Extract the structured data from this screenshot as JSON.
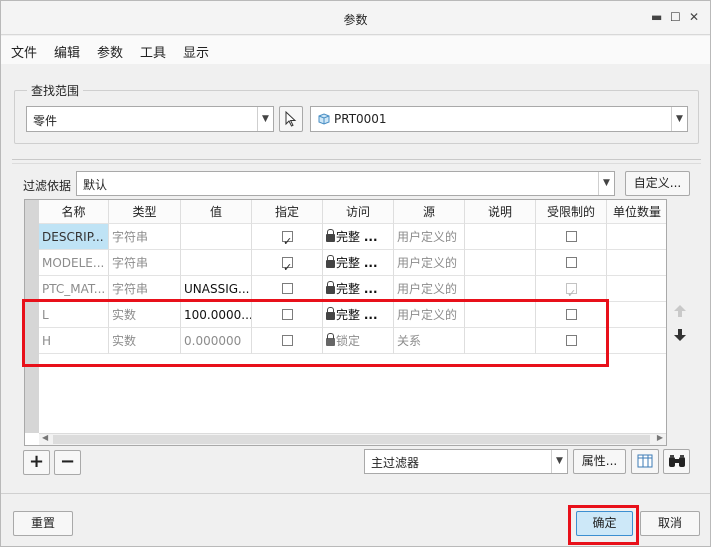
{
  "window": {
    "title": "参数",
    "minimize": "▬",
    "maximize": "☐",
    "close": "✕"
  },
  "menu": [
    "文件",
    "编辑",
    "参数",
    "工具",
    "显示"
  ],
  "search_scope": {
    "label": "查找范围",
    "type_value": "零件",
    "part_value": "PRT0001"
  },
  "filter": {
    "label": "过滤依据",
    "value": "默认",
    "customize_label": "自定义..."
  },
  "table": {
    "columns": [
      "名称",
      "类型",
      "值",
      "指定",
      "访问",
      "源",
      "说明",
      "受限制的",
      "单位数量"
    ],
    "rows": [
      {
        "name": "DESCRIP...",
        "type": "字符串",
        "value": "",
        "designated": true,
        "access": "完整",
        "source": "用户定义的",
        "restricted": false,
        "restricted_disabled": false
      },
      {
        "name": "MODELE...",
        "type": "字符串",
        "value": "",
        "designated": true,
        "access": "完整",
        "source": "用户定义的",
        "restricted": false,
        "restricted_disabled": false
      },
      {
        "name": "PTC_MAT...",
        "type": "字符串",
        "value": "UNASSIG...",
        "designated": false,
        "access": "完整",
        "source": "用户定义的",
        "restricted": true,
        "restricted_disabled": true
      },
      {
        "name": "L",
        "type": "实数",
        "value": "100.0000...",
        "designated": false,
        "access": "完整",
        "source": "用户定义的",
        "restricted": false,
        "restricted_disabled": false
      },
      {
        "name": "H",
        "type": "实数",
        "value": "0.000000",
        "designated": false,
        "access": "锁定",
        "source": "关系",
        "restricted": false,
        "restricted_disabled": false
      }
    ],
    "ellipsis": "..."
  },
  "bottom": {
    "add": "+",
    "remove": "−",
    "main_filter": "主过滤器",
    "properties": "属性...",
    "reset": "重置",
    "ok": "确定",
    "cancel": "取消"
  },
  "colors": {
    "highlight": "#e8101a",
    "selected_cell": "#bfe3f5"
  }
}
